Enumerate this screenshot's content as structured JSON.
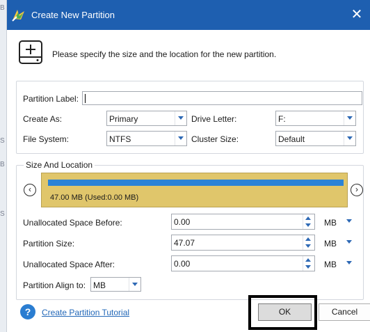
{
  "window": {
    "title": "Create New Partition",
    "close_glyph": "✕"
  },
  "header": {
    "instruction": "Please specify the size and the location for the new partition."
  },
  "form": {
    "partition_label": {
      "label": "Partition Label:",
      "value": ""
    },
    "create_as": {
      "label": "Create As:",
      "value": "Primary"
    },
    "drive_letter": {
      "label": "Drive Letter:",
      "value": "F:"
    },
    "file_system": {
      "label": "File System:",
      "value": "NTFS"
    },
    "cluster_size": {
      "label": "Cluster Size:",
      "value": "Default"
    }
  },
  "size_location": {
    "title": "Size And Location",
    "prev_glyph": "‹",
    "next_glyph": "›",
    "disk_info": "47.00 MB (Used:0.00 MB)",
    "colors": {
      "disk_block": "#e0c66b",
      "used_bar": "#2b83d6"
    },
    "unallocated_before": {
      "label": "Unallocated Space Before:",
      "value": "0.00",
      "unit": "MB"
    },
    "partition_size": {
      "label": "Partition Size:",
      "value": "47.07",
      "unit": "MB"
    },
    "unallocated_after": {
      "label": "Unallocated Space After:",
      "value": "0.00",
      "unit": "MB"
    },
    "align": {
      "label": "Partition Align to:",
      "value": "MB"
    }
  },
  "footer": {
    "help_glyph": "?",
    "tutorial_link": "Create Partition Tutorial",
    "ok_label": "OK",
    "cancel_label": "Cancel"
  },
  "background": {
    "left_marks": [
      "B",
      "S",
      "B",
      "S"
    ]
  },
  "icons": [
    "app-icon",
    "close-icon",
    "add-disk-icon",
    "chevron-left-icon",
    "chevron-right-icon",
    "help-icon"
  ]
}
